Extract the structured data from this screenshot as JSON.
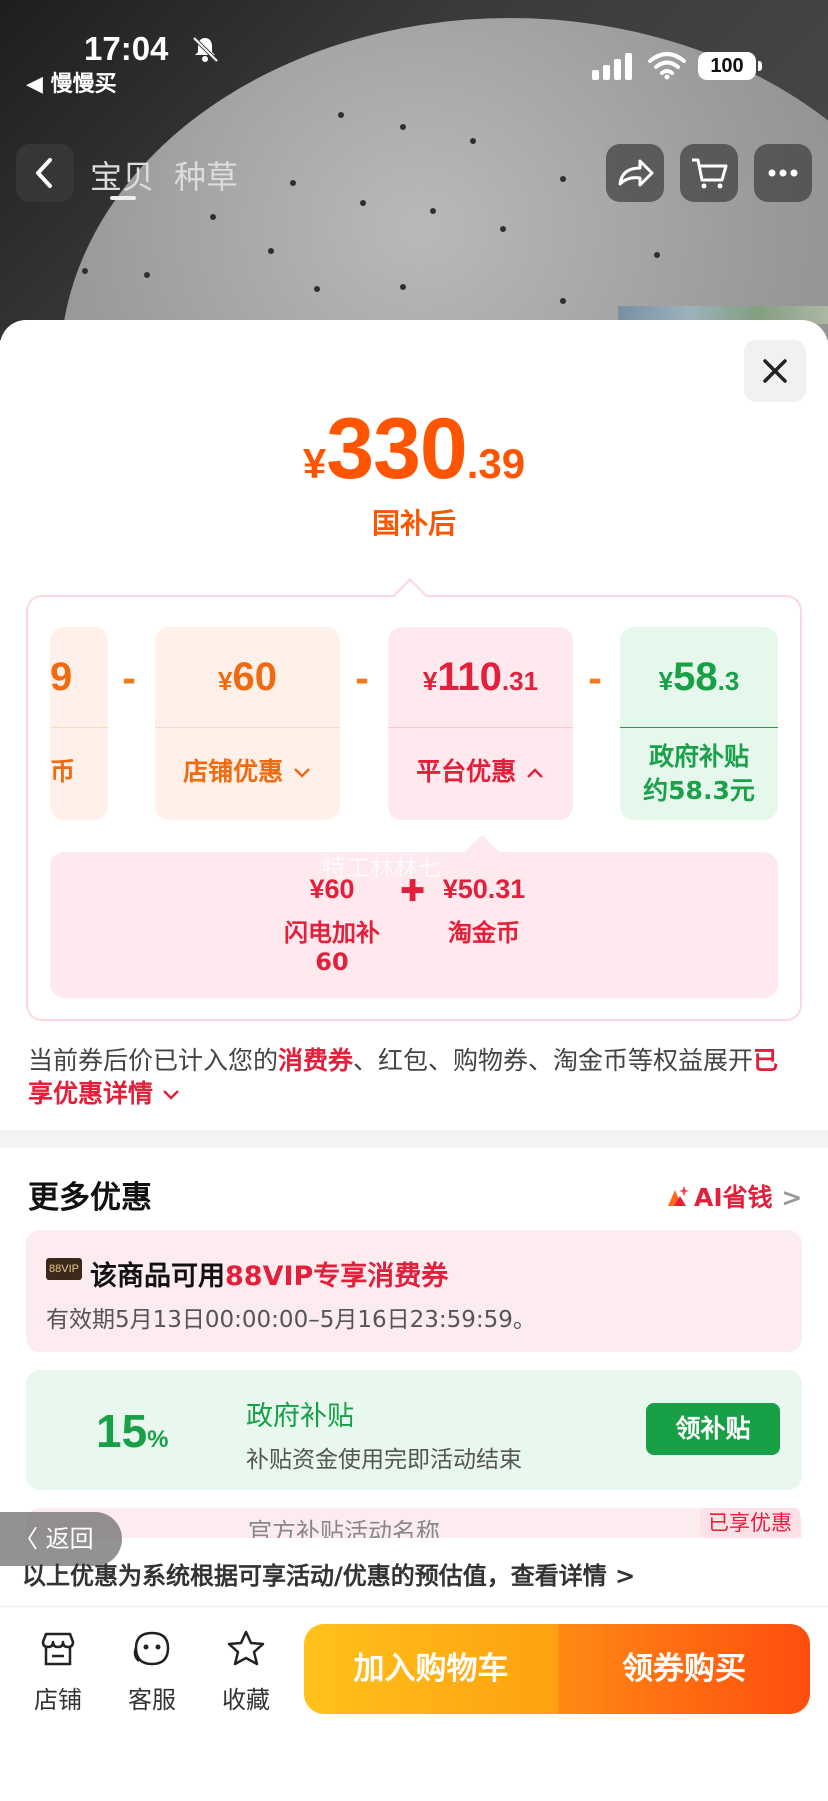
{
  "status_bar": {
    "time": "17:04",
    "back_app": "◀ 慢慢买",
    "battery": "100"
  },
  "nav": {
    "tabs": [
      "宝贝",
      "种草"
    ]
  },
  "price": {
    "currency": "¥",
    "integer": "330",
    "decimal": ".39",
    "label": "国补后"
  },
  "breakdown": {
    "cut_card": {
      "value": "9",
      "label": "币"
    },
    "shop_card": {
      "currency": "¥",
      "value": "60",
      "label": "店铺优惠",
      "chevron": "⌄"
    },
    "platform_card": {
      "currency": "¥",
      "value": "110",
      "decimal": ".31",
      "label": "平台优惠",
      "chevron": "^"
    },
    "gov_card": {
      "currency": "¥",
      "value": "58",
      "decimal": ".3",
      "label_line1": "政府补贴",
      "label_line2": "约58.3元"
    },
    "minus": "-",
    "sub_items": [
      {
        "value": "¥60",
        "label": "闪电加补",
        "label2": "60"
      },
      {
        "value": "¥50.31",
        "label": "淘金币"
      }
    ],
    "plus": "✚",
    "watermark": "特工林林七"
  },
  "note": {
    "prefix": "当前券后价已计入您的",
    "highlight": "消费券",
    "middle": "、红包、购物券、淘金币等权益展开",
    "link": "已享优惠详情",
    "chevron": "⌄"
  },
  "more": {
    "title": "更多优惠",
    "ai_link": "AI省钱",
    "ai_chevron": ">",
    "vip": {
      "badge": "88VIP",
      "title_prefix": "该商品可用",
      "title_highlight": "88VIP专享消费券",
      "date": "有效期5月13日00:00:00–5月16日23:59:59。"
    },
    "gov": {
      "pct_number": "15",
      "pct_sign": "%",
      "title": "政府补贴",
      "desc": "补贴资金使用完即活动结束",
      "button": "领补贴"
    },
    "partial_text": "官方补贴活动名称",
    "enjoyed": "已享优惠"
  },
  "back_pill": "〈 返回",
  "disclaimer": "以上优惠为系统根据可享活动/优惠的预估值，查看详情 >",
  "bottom_bar": {
    "shop": "店铺",
    "service": "客服",
    "favorite": "收藏",
    "add_to_cart": "加入购物车",
    "buy": "领券购买"
  },
  "colors": {
    "accent_orange": "#ff5500",
    "accent_red": "#e2203b",
    "green": "#17a046"
  }
}
